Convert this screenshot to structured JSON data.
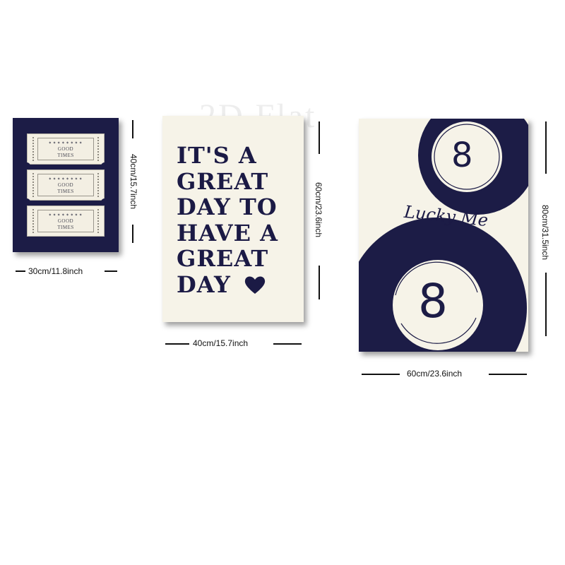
{
  "watermark": "2D Flat",
  "posters": {
    "small": {
      "ticket_text_line1": "GOOD",
      "ticket_text_line2": "TIMES",
      "height_label": "40cm/15.7inch",
      "width_label": "30cm/11.8inch"
    },
    "medium": {
      "quote_lines": [
        "IT'S A",
        "GREAT",
        "DAY TO",
        "HAVE A",
        "GREAT",
        "DAY"
      ],
      "height_label": "60cm/23.6inch",
      "width_label": "40cm/15.7inch"
    },
    "large": {
      "ball_number_top": "8",
      "ball_number_bottom": "8",
      "script_text": "Lucky Me",
      "height_label": "80cm/31.5inch",
      "width_label": "60cm/23.6inch"
    }
  },
  "colors": {
    "navy": "#1c1c46",
    "cream": "#f6f3e8",
    "ticket": "#f3efe3"
  },
  "icons": [
    "ticket-icon",
    "heart-icon",
    "eight-ball-icon"
  ]
}
